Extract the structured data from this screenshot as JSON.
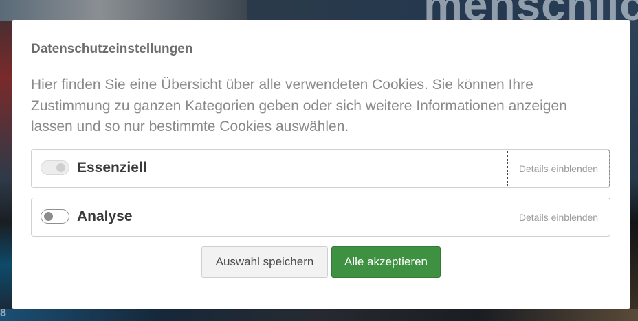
{
  "background": {
    "heading": "menschlic",
    "bottom_text": "8"
  },
  "dialog": {
    "title": "Datenschutzeinstellungen",
    "description": "Hier finden Sie eine Übersicht über alle verwendeten Cookies. Sie können Ihre Zustimmung zu ganzen Kategorien geben oder sich weitere Informationen anzeigen lassen und so nur bestimmte Cookies auswählen.",
    "categories": [
      {
        "label": "Essenziell",
        "toggle_state": "on-disabled",
        "details_label": "Details einblenden"
      },
      {
        "label": "Analyse",
        "toggle_state": "off",
        "details_label": "Details einblenden"
      }
    ],
    "buttons": {
      "save_label": "Auswahl speichern",
      "accept_label": "Alle akzeptieren"
    },
    "colors": {
      "accept_button": "#3f9142",
      "title_text": "#6d6d6d",
      "body_text": "#8a8a8a"
    }
  }
}
